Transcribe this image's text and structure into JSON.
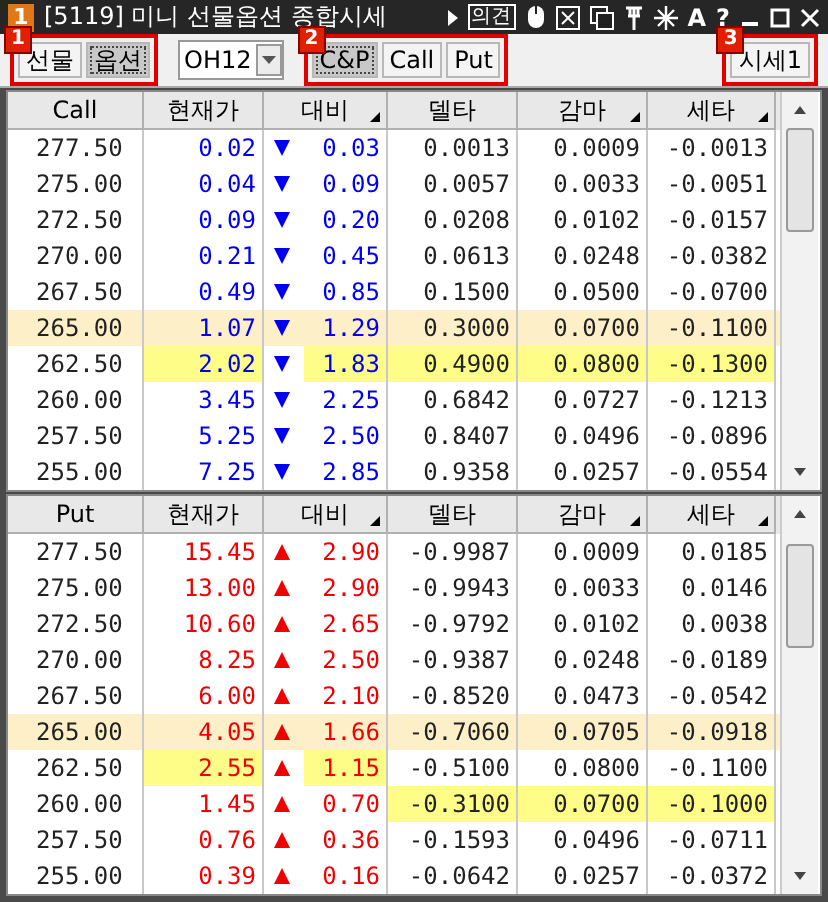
{
  "window": {
    "badge": "1",
    "title": "[5119] 미니 선물옵션 종합시세",
    "opinion": "의견",
    "help": "?",
    "font_button": "A"
  },
  "toolbar": {
    "groups": [
      {
        "badge": "1",
        "buttons": [
          {
            "label": "선물",
            "selected": false
          },
          {
            "label": "옵션",
            "selected": true
          }
        ]
      },
      {
        "badge": "2",
        "buttons": [
          {
            "label": "C&P",
            "selected": true
          },
          {
            "label": "Call",
            "selected": false
          },
          {
            "label": "Put",
            "selected": false
          }
        ]
      },
      {
        "badge": "3",
        "buttons": [
          {
            "label": "시세1",
            "selected": false
          }
        ]
      }
    ],
    "month": "OH12"
  },
  "tables": [
    {
      "columns": [
        {
          "label": "Call",
          "sortable": false
        },
        {
          "label": "현재가",
          "sortable": false
        },
        {
          "label": "대비",
          "sortable": true
        },
        {
          "label": "델타",
          "sortable": false
        },
        {
          "label": "감마",
          "sortable": true
        },
        {
          "label": "세타",
          "sortable": true
        }
      ],
      "rows": [
        {
          "strike": "277.50",
          "price": "0.02",
          "rising": false,
          "change": "0.03",
          "delta": "0.0013",
          "gamma": "0.0009",
          "theta": "-0.0013",
          "atm": false,
          "hl": {
            "price": false,
            "change": false,
            "delta": false,
            "gamma": false,
            "theta": false
          }
        },
        {
          "strike": "275.00",
          "price": "0.04",
          "rising": false,
          "change": "0.09",
          "delta": "0.0057",
          "gamma": "0.0033",
          "theta": "-0.0051",
          "atm": false,
          "hl": {
            "price": false,
            "change": false,
            "delta": false,
            "gamma": false,
            "theta": false
          }
        },
        {
          "strike": "272.50",
          "price": "0.09",
          "rising": false,
          "change": "0.20",
          "delta": "0.0208",
          "gamma": "0.0102",
          "theta": "-0.0157",
          "atm": false,
          "hl": {
            "price": false,
            "change": false,
            "delta": false,
            "gamma": false,
            "theta": false
          }
        },
        {
          "strike": "270.00",
          "price": "0.21",
          "rising": false,
          "change": "0.45",
          "delta": "0.0613",
          "gamma": "0.0248",
          "theta": "-0.0382",
          "atm": false,
          "hl": {
            "price": false,
            "change": false,
            "delta": false,
            "gamma": false,
            "theta": false
          }
        },
        {
          "strike": "267.50",
          "price": "0.49",
          "rising": false,
          "change": "0.85",
          "delta": "0.1500",
          "gamma": "0.0500",
          "theta": "-0.0700",
          "atm": false,
          "hl": {
            "price": false,
            "change": false,
            "delta": false,
            "gamma": false,
            "theta": false
          }
        },
        {
          "strike": "265.00",
          "price": "1.07",
          "rising": false,
          "change": "1.29",
          "delta": "0.3000",
          "gamma": "0.0700",
          "theta": "-0.1100",
          "atm": true,
          "hl": {
            "price": false,
            "change": false,
            "delta": false,
            "gamma": false,
            "theta": false
          }
        },
        {
          "strike": "262.50",
          "price": "2.02",
          "rising": false,
          "change": "1.83",
          "delta": "0.4900",
          "gamma": "0.0800",
          "theta": "-0.1300",
          "atm": false,
          "hl": {
            "price": true,
            "change": true,
            "delta": true,
            "gamma": true,
            "theta": true
          }
        },
        {
          "strike": "260.00",
          "price": "3.45",
          "rising": false,
          "change": "2.25",
          "delta": "0.6842",
          "gamma": "0.0727",
          "theta": "-0.1213",
          "atm": false,
          "hl": {
            "price": false,
            "change": false,
            "delta": false,
            "gamma": false,
            "theta": false
          }
        },
        {
          "strike": "257.50",
          "price": "5.25",
          "rising": false,
          "change": "2.50",
          "delta": "0.8407",
          "gamma": "0.0496",
          "theta": "-0.0896",
          "atm": false,
          "hl": {
            "price": false,
            "change": false,
            "delta": false,
            "gamma": false,
            "theta": false
          }
        },
        {
          "strike": "255.00",
          "price": "7.25",
          "rising": false,
          "change": "2.85",
          "delta": "0.9358",
          "gamma": "0.0257",
          "theta": "-0.0554",
          "atm": false,
          "hl": {
            "price": false,
            "change": false,
            "delta": false,
            "gamma": false,
            "theta": false
          }
        }
      ]
    },
    {
      "columns": [
        {
          "label": "Put",
          "sortable": false
        },
        {
          "label": "현재가",
          "sortable": false
        },
        {
          "label": "대비",
          "sortable": true
        },
        {
          "label": "델타",
          "sortable": false
        },
        {
          "label": "감마",
          "sortable": true
        },
        {
          "label": "세타",
          "sortable": true
        }
      ],
      "rows": [
        {
          "strike": "277.50",
          "price": "15.45",
          "rising": true,
          "change": "2.90",
          "delta": "-0.9987",
          "gamma": "0.0009",
          "theta": "0.0185",
          "atm": false,
          "hl": {
            "price": false,
            "change": false,
            "delta": false,
            "gamma": false,
            "theta": false
          }
        },
        {
          "strike": "275.00",
          "price": "13.00",
          "rising": true,
          "change": "2.90",
          "delta": "-0.9943",
          "gamma": "0.0033",
          "theta": "0.0146",
          "atm": false,
          "hl": {
            "price": false,
            "change": false,
            "delta": false,
            "gamma": false,
            "theta": false
          }
        },
        {
          "strike": "272.50",
          "price": "10.60",
          "rising": true,
          "change": "2.65",
          "delta": "-0.9792",
          "gamma": "0.0102",
          "theta": "0.0038",
          "atm": false,
          "hl": {
            "price": false,
            "change": false,
            "delta": false,
            "gamma": false,
            "theta": false
          }
        },
        {
          "strike": "270.00",
          "price": "8.25",
          "rising": true,
          "change": "2.50",
          "delta": "-0.9387",
          "gamma": "0.0248",
          "theta": "-0.0189",
          "atm": false,
          "hl": {
            "price": false,
            "change": false,
            "delta": false,
            "gamma": false,
            "theta": false
          }
        },
        {
          "strike": "267.50",
          "price": "6.00",
          "rising": true,
          "change": "2.10",
          "delta": "-0.8520",
          "gamma": "0.0473",
          "theta": "-0.0542",
          "atm": false,
          "hl": {
            "price": false,
            "change": false,
            "delta": false,
            "gamma": false,
            "theta": false
          }
        },
        {
          "strike": "265.00",
          "price": "4.05",
          "rising": true,
          "change": "1.66",
          "delta": "-0.7060",
          "gamma": "0.0705",
          "theta": "-0.0918",
          "atm": true,
          "hl": {
            "price": false,
            "change": false,
            "delta": false,
            "gamma": false,
            "theta": false
          }
        },
        {
          "strike": "262.50",
          "price": "2.55",
          "rising": true,
          "change": "1.15",
          "delta": "-0.5100",
          "gamma": "0.0800",
          "theta": "-0.1100",
          "atm": false,
          "hl": {
            "price": true,
            "change": true,
            "delta": false,
            "gamma": false,
            "theta": false
          }
        },
        {
          "strike": "260.00",
          "price": "1.45",
          "rising": true,
          "change": "0.70",
          "delta": "-0.3100",
          "gamma": "0.0700",
          "theta": "-0.1000",
          "atm": false,
          "hl": {
            "price": false,
            "change": false,
            "delta": true,
            "gamma": true,
            "theta": true
          }
        },
        {
          "strike": "257.50",
          "price": "0.76",
          "rising": true,
          "change": "0.36",
          "delta": "-0.1593",
          "gamma": "0.0496",
          "theta": "-0.0711",
          "atm": false,
          "hl": {
            "price": false,
            "change": false,
            "delta": false,
            "gamma": false,
            "theta": false
          }
        },
        {
          "strike": "255.00",
          "price": "0.39",
          "rising": true,
          "change": "0.16",
          "delta": "-0.0642",
          "gamma": "0.0257",
          "theta": "-0.0372",
          "atm": false,
          "hl": {
            "price": false,
            "change": false,
            "delta": false,
            "gamma": false,
            "theta": false
          }
        }
      ]
    }
  ]
}
